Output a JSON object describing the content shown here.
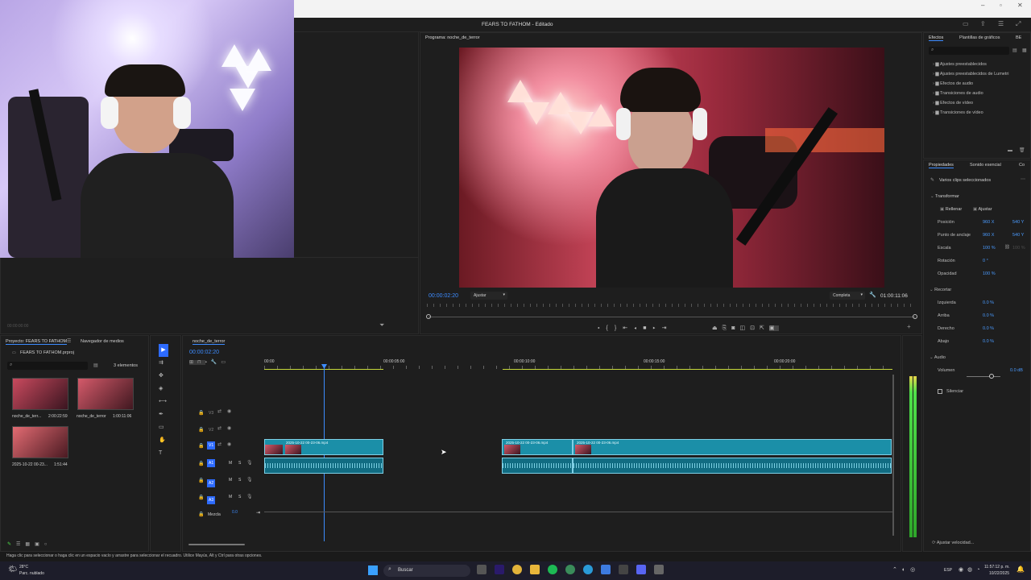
{
  "window": {
    "title": "FEARS TO FATHOM - Editado"
  },
  "program": {
    "tab_label": "Programa: noche_de_terror",
    "timecode": "00:00:02:20",
    "fit_label": "Ajustar",
    "quality_label": "Completa",
    "duration": "01:00:11:06"
  },
  "source": {
    "timecode": "00:00:00:00"
  },
  "effects": {
    "tabs": [
      "Efectos",
      "Plantillas de gráficos",
      "BE"
    ],
    "items": [
      "Ajustes preestablecidos",
      "Ajustes preestablecidos de Lumetri",
      "Efectos de audio",
      "Transiciones de audio",
      "Efectos de vídeo",
      "Transiciones de vídeo"
    ]
  },
  "properties": {
    "tabs": [
      "Propiedades",
      "Sonido esencial",
      "Co"
    ],
    "selection": "Varios clips seleccionados",
    "transform_header": "Transformar",
    "fill_label": "Rellenar",
    "fit_label": "Ajustar",
    "position_label": "Posición",
    "position_x": "960 X",
    "position_y": "540 Y",
    "anchor_label": "Punto de anclaje",
    "anchor_x": "960 X",
    "anchor_y": "540 Y",
    "scale_label": "Escala",
    "scale_value": "100 %",
    "scale_value2": "100 %",
    "rotation_label": "Rotación",
    "rotation_value": "0 °",
    "opacity_label": "Opacidad",
    "opacity_value": "100 %",
    "crop_header": "Recortar",
    "crop_left_label": "Izquierda",
    "crop_left": "0.0 %",
    "crop_top_label": "Arriba",
    "crop_top": "0.0 %",
    "crop_right_label": "Derecho",
    "crop_right": "0.0 %",
    "crop_bottom_label": "Abajo",
    "crop_bottom": "0.0 %",
    "audio_header": "Audio",
    "volume_label": "Volumen",
    "volume_value": "0.0 dB",
    "mute_label": "Silenciar",
    "speed_label": "Ajustar velocidad..."
  },
  "project": {
    "tabs": [
      "Proyecto: FEARS TO FATHOM",
      "Navegador de medios"
    ],
    "file": "FEARS TO FATHOM.prproj",
    "count": "3 elementos",
    "items": [
      {
        "name": "noche_de_terr...",
        "duration": "2:00:22:59"
      },
      {
        "name": "noche_de_terror",
        "duration": "1:00:11:06"
      },
      {
        "name": "2025-10-22 00-23...",
        "duration": "1:51:44"
      }
    ]
  },
  "timeline": {
    "tab_label": "noche_de_terror",
    "timecode": "00:00:02:20",
    "ruler": [
      "00:00",
      "00:00:05:00",
      "00:00:10:00",
      "00:00:15:00",
      "00:00:20:00"
    ],
    "tracks": [
      "V3",
      "V2",
      "V1",
      "A1",
      "A2",
      "A3"
    ],
    "mix_label": "Mezcla",
    "mix_value": "0.0",
    "clips": [
      {
        "name": "2025-10-22 00-23-06.mp4"
      },
      {
        "name": "2025-10-22 00-23-06.mp4"
      },
      {
        "name": "2025-10-22 00-23-06.mp4"
      }
    ]
  },
  "status": {
    "text": "Haga clic para seleccionar o haga clic en un espacio vacío y arrastre para seleccionar el recuadro. Utilice Mayús, Alt y Ctrl para otras opciones."
  },
  "taskbar": {
    "weather_temp": "28°C",
    "weather_desc": "Parc. nublado",
    "search_placeholder": "Buscar",
    "lang": "ESP",
    "time": "11:57:12 p. m.",
    "date": "10/22/2025"
  },
  "colors": {
    "accent": "#2d8cff",
    "clip": "#1b8fa8",
    "playhead": "#3d8cff",
    "meter": "#4fe04a"
  }
}
